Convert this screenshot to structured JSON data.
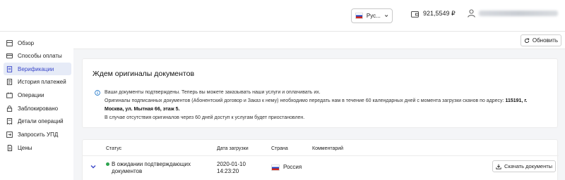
{
  "header": {
    "language": "Рус...",
    "balance": "921,5549 ₽"
  },
  "sidebar": {
    "items": [
      {
        "label": "Обзор",
        "icon": "grid-icon"
      },
      {
        "label": "Способы оплаты",
        "icon": "card-icon"
      },
      {
        "label": "Верификации",
        "icon": "document-icon",
        "active": true
      },
      {
        "label": "История платежей",
        "icon": "history-icon"
      },
      {
        "label": "Операции",
        "icon": "operations-icon"
      },
      {
        "label": "Заблокировано",
        "icon": "lock-icon"
      },
      {
        "label": "Детали операций",
        "icon": "receipt-icon"
      },
      {
        "label": "Запросить УПД",
        "icon": "send-icon"
      },
      {
        "label": "Цены",
        "icon": "prices-icon"
      }
    ]
  },
  "toolbar": {
    "refresh_label": "Обновить"
  },
  "card": {
    "title": "Ждем оригиналы документов",
    "line1": "Ваши документы подтверждены. Теперь вы можете заказывать наши услуги и оплачивать их.",
    "line2_text": "Оригиналы подписанных документов (Абонентский договор и Заказ к нему) необходимо передать нам в течение 60 календарных дней с момента загрузки сканов по адресу:",
    "line2_bold": "115191, г.",
    "line3_bold": "Москва, ул. Мытная 66, этаж 5.",
    "line4": "В случае отсутствия оригиналов через 60 дней доступ к услугам будет приостановлен."
  },
  "table": {
    "columns": {
      "status": "Статус",
      "date": "Дата загрузки",
      "country": "Страна",
      "comment": "Комментарий"
    },
    "rows": [
      {
        "status_line1": "В ожидании подтверждающих",
        "status_line2": "документов",
        "status_color": "#2ea44f",
        "date_line1": "2020-01-10",
        "date_line2": "14:23:20",
        "country": "Россия",
        "comment": "",
        "download_label": "Скачать документы"
      }
    ]
  },
  "colors": {
    "accent": "#3a47c9",
    "active_bg": "#e6ebf7",
    "success": "#2ea44f",
    "info": "#1a73c8"
  }
}
